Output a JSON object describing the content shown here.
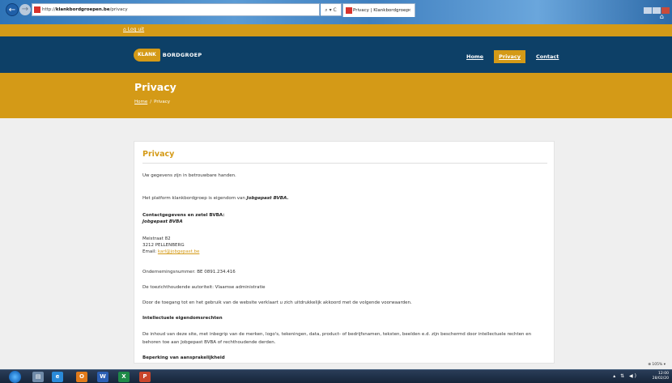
{
  "browser": {
    "url_prefix": "http://",
    "url_domain": "klankbordgroepen.be",
    "url_path": "/privacy",
    "address_controls": "⌕ ▾ C",
    "tab_title": "Privacy | Klankbordgroep",
    "tab_close": "×",
    "back_glyph": "←",
    "forward_glyph": "→",
    "zoom": "⊕ 105% ▾"
  },
  "topbar": {
    "logout": "⌂ Log uit"
  },
  "header": {
    "logo_pill": "KLANK",
    "logo_text": "BORDGROEP",
    "menu": {
      "home": "Home",
      "privacy": "Privacy",
      "contact": "Contact"
    }
  },
  "banner": {
    "title": "Privacy",
    "crumb_home": "Home",
    "crumb_sep": "/",
    "crumb_current": "Privacy"
  },
  "content": {
    "title": "Privacy",
    "p1": "Uw gegevens zijn in betrouwbare handen.",
    "p2_text": "Het platform klankbordgroep is eigendom van ",
    "p2_company": "Jobgepast BVBA.",
    "contact_heading": "Contactgegevens en zetel BVBA:",
    "contact_company": "Jobgepast BVBA",
    "street": "Meistraat 82",
    "city": "3212 PELLENBERG",
    "email_label": "Email: ",
    "email": "karl@jobgepast.be",
    "company_number": "Ondernemingsnummer: BE 0891.234.416",
    "authority": "De toezichthoudende autoriteit: Vlaamse administratie",
    "agreement": "Door de toegang tot en het gebruik van de website verklaart u zich uitdrukkelijk akkoord met de volgende voorwaarden.",
    "ip_heading": "Intellectuele eigendomsrechten",
    "ip_line1": "De inhoud van deze site, met inbegrip van de merken, logo's, tekeningen, data, product- of bedrijfsnamen, teksten, beelden e.d. zijn beschermd door intellectuele rechten en",
    "ip_line2": "behoren toe aan Jobgepast BVBA of rechthoudende derden.",
    "liability_heading": "Beperking van aansprakelijkheid"
  },
  "taskbar": {
    "apps": [
      "e",
      "O",
      "W",
      "X",
      "P"
    ],
    "time": "12:00",
    "date": "28/02/20"
  }
}
